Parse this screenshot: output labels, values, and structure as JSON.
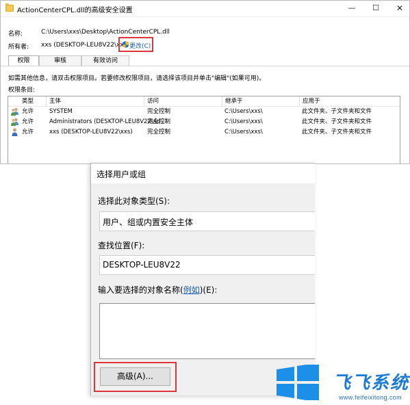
{
  "window": {
    "title": "ActionCenterCPL.dll的高级安全设置",
    "minimize_glyph": "—",
    "maximize_glyph": "☐",
    "close_glyph": "✕"
  },
  "info": {
    "name_label": "名称:",
    "name_value": "C:\\Users\\xxs\\Desktop\\ActionCenterCPL.dll",
    "owner_label": "所有者:",
    "owner_value": "xxs (DESKTOP-LEU8V22\\xxs)",
    "change_label": "更改(C)"
  },
  "tabs": [
    {
      "label": "权限"
    },
    {
      "label": "审核"
    },
    {
      "label": "有效访问"
    }
  ],
  "hint_text": "如需其他信息，请双击权限项目。若要修改权限项目，请选择该项目并单击\"编辑\"(如果可用)。",
  "entries_label": "权限条目:",
  "table": {
    "headers": [
      "类型",
      "主体",
      "访问",
      "继承于",
      "应用于"
    ],
    "rows": [
      {
        "type": "允许",
        "principal": "SYSTEM",
        "access": "完全控制",
        "inherit": "C:\\Users\\xxs\\",
        "apply": "此文件夹、子文件夹和文件",
        "icon": "group-icon"
      },
      {
        "type": "允许",
        "principal": "Administrators (DESKTOP-LEU8V22\\Ad...",
        "access": "完全控制",
        "inherit": "C:\\Users\\xxs\\",
        "apply": "此文件夹、子文件夹和文件",
        "icon": "group-icon"
      },
      {
        "type": "允许",
        "principal": "xxs (DESKTOP-LEU8V22\\xxs)",
        "access": "完全控制",
        "inherit": "C:\\Users\\xxs\\",
        "apply": "此文件夹、子文件夹和文件",
        "icon": "user-icon"
      }
    ]
  },
  "dialog": {
    "title": "选择用户或组",
    "type_label": "选择此对象类型(S):",
    "type_value": "用户、组或内置安全主体",
    "location_label": "查找位置(F):",
    "location_value": "DESKTOP-LEU8V22",
    "names_label_pre": "输入要选择的对象名称(",
    "names_label_link": "例如",
    "names_label_post": ")(E):",
    "names_value": "",
    "advanced_label": "高级(A)..."
  },
  "watermark": {
    "text": "飞飞系统",
    "url": "www.feifeixitong.com"
  },
  "colors": {
    "highlight_red": "#e0353a",
    "link_blue": "#1a5fb4",
    "brand_blue": "#1d7bd6"
  }
}
